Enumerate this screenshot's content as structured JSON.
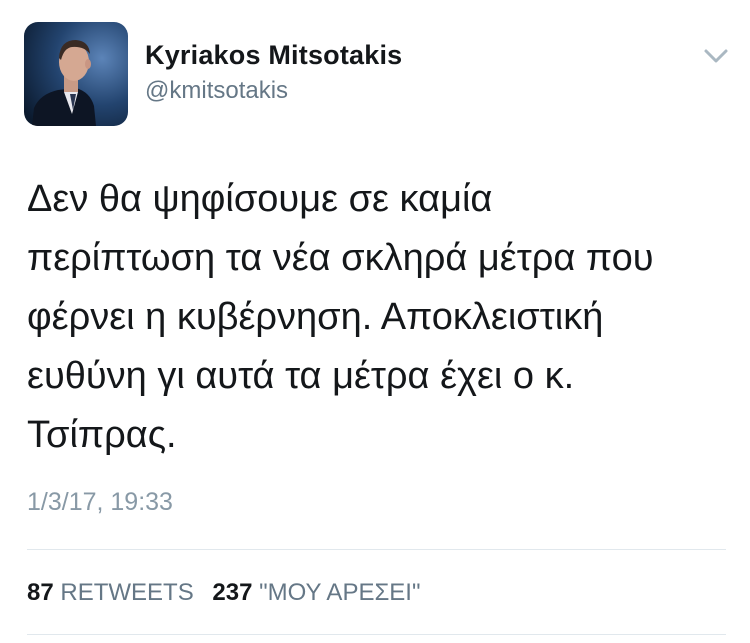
{
  "author": {
    "name": "Kyriakos Mitsotakis",
    "handle": "@kmitsotakis"
  },
  "icons": {
    "menu": "chevron-down-icon"
  },
  "tweet": {
    "lines": [
      "Δεν θα ψηφίσουμε σε καμία",
      "περίπτωση τα νέα σκληρά μέτρα που",
      "φέρνει η κυβέρνηση. Αποκλειστική",
      "ευθύνη γι αυτά τα μέτρα έχει ο κ.",
      "Τσίπρας."
    ],
    "timestamp": "1/3/17, 19:33"
  },
  "stats": {
    "retweets_count": "87",
    "retweets_label": "RETWEETS",
    "likes_count": "237",
    "likes_label": "\"ΜΟΥ ΑΡΕΣΕΙ\""
  },
  "colors": {
    "text": "#14171a",
    "secondary": "#657786",
    "timestamp": "#8899a6",
    "divider": "#e1e8ed"
  }
}
